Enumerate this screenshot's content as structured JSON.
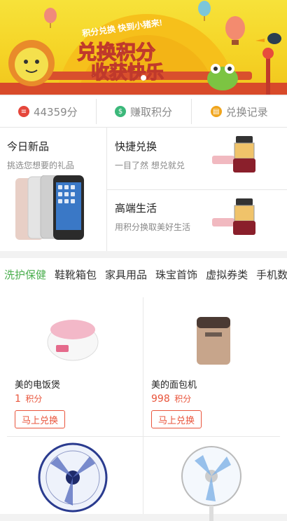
{
  "banner": {
    "top_label": "积分兑换 快到小猪来!",
    "line1": "兑换积分",
    "line2": "收获快乐"
  },
  "stats": [
    {
      "label": "44359分",
      "icon": "coin-stack-icon",
      "color": "#e5463b"
    },
    {
      "label": "赚取积分",
      "icon": "money-bag-icon",
      "color": "#3bb87a"
    },
    {
      "label": "兑换记录",
      "icon": "record-icon",
      "color": "#f0a51d"
    }
  ],
  "features": {
    "new": {
      "title": "今日新品",
      "sub": "挑选您想要的礼品"
    },
    "quick": {
      "title": "快捷兑换",
      "sub": "一目了然 想兑就兑"
    },
    "premium": {
      "title": "高端生活",
      "sub": "用积分换取美好生活"
    }
  },
  "categories": [
    "洗护保健",
    "鞋靴箱包",
    "家具用品",
    "珠宝首饰",
    "虚拟券类",
    "手机数"
  ],
  "products": [
    {
      "name": "美的电饭煲",
      "price": "1",
      "unit": "积分",
      "button": "马上兑换"
    },
    {
      "name": "美的面包机",
      "price": "998",
      "unit": "积分",
      "button": "马上兑换"
    }
  ],
  "colors": {
    "accent": "#e9553c",
    "active_cat": "#4caf50",
    "banner": "#f5d426"
  }
}
